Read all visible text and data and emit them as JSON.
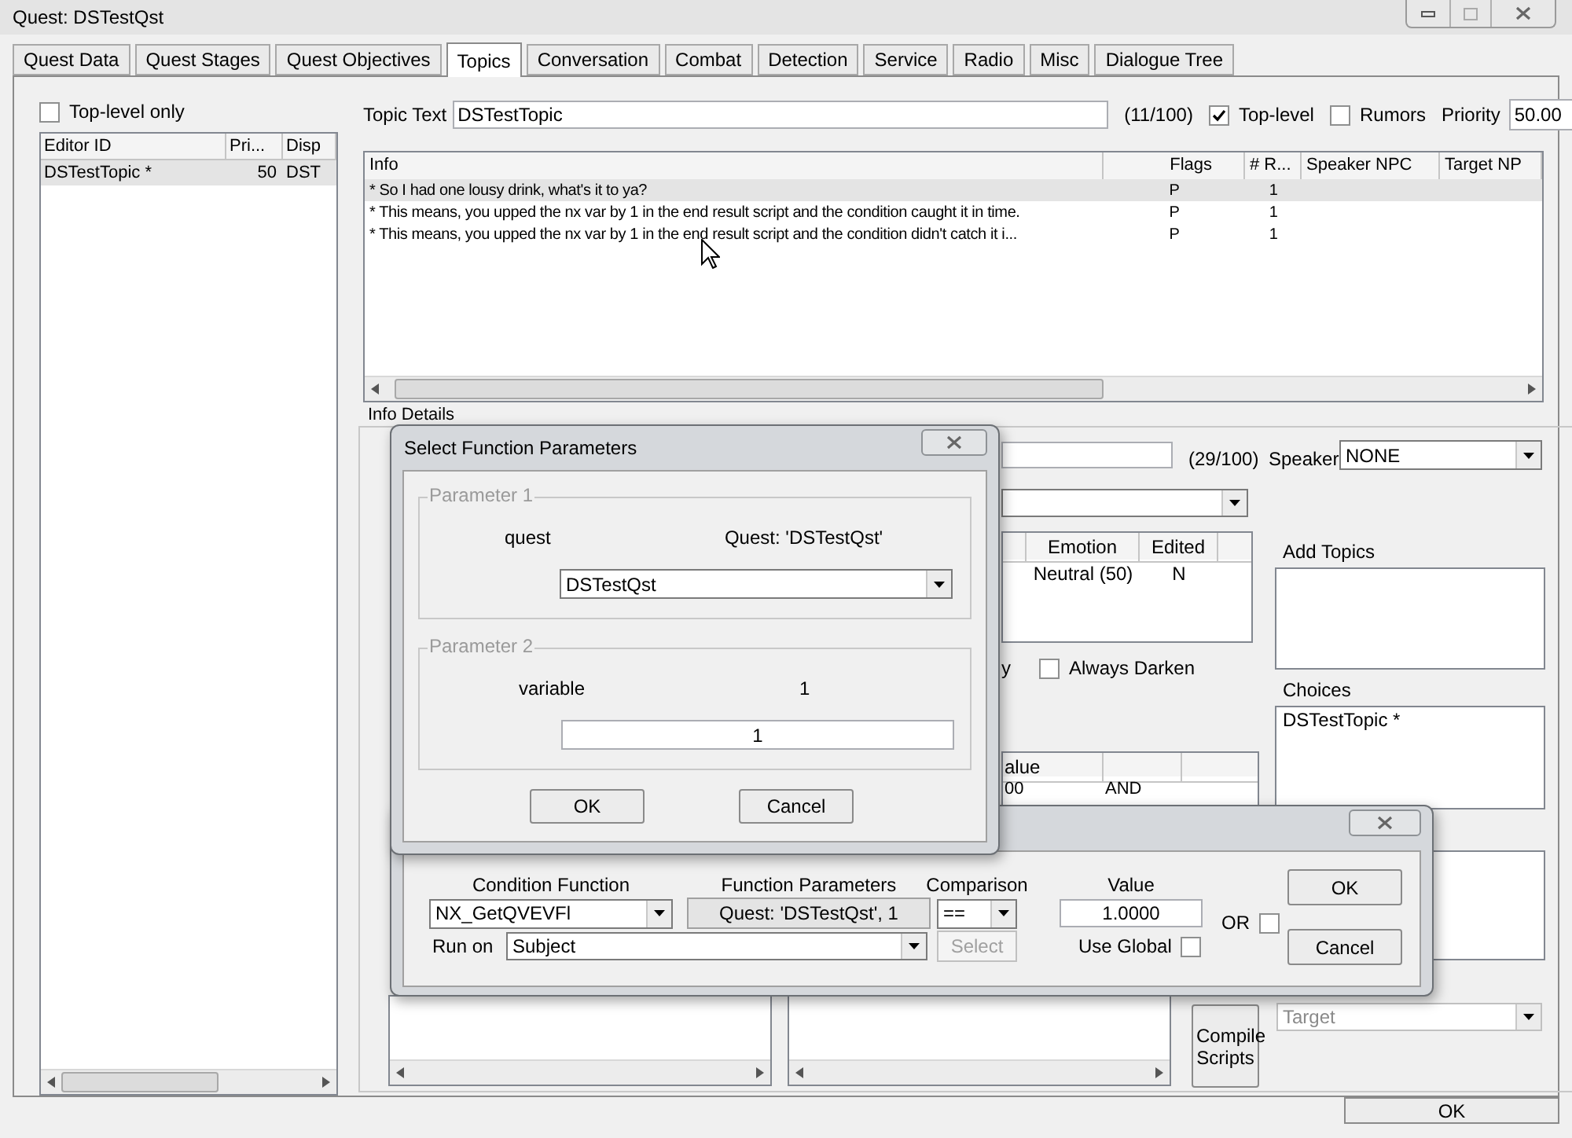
{
  "window": {
    "title": "Quest: DSTestQst"
  },
  "tabs": [
    {
      "label": "Quest Data",
      "selected": false
    },
    {
      "label": "Quest Stages",
      "selected": false
    },
    {
      "label": "Quest Objectives",
      "selected": false
    },
    {
      "label": "Topics",
      "selected": true
    },
    {
      "label": "Conversation",
      "selected": false
    },
    {
      "label": "Combat",
      "selected": false
    },
    {
      "label": "Detection",
      "selected": false
    },
    {
      "label": "Service",
      "selected": false
    },
    {
      "label": "Radio",
      "selected": false
    },
    {
      "label": "Misc",
      "selected": false
    },
    {
      "label": "Dialogue Tree",
      "selected": false
    }
  ],
  "topic_list": {
    "top_level_only": {
      "label": "Top-level only",
      "checked": false
    },
    "columns": [
      "Editor ID",
      "Pri...",
      "Disp"
    ],
    "rows": [
      {
        "cells": [
          "DSTestTopic *",
          "50",
          "DST"
        ],
        "selected": true
      }
    ]
  },
  "topic": {
    "label": "Topic Text",
    "value": "DSTestTopic",
    "count": "(11/100)",
    "top_level": {
      "label": "Top-level",
      "checked": true
    },
    "rumors": {
      "label": "Rumors",
      "checked": false
    },
    "priority_label": "Priority",
    "priority": "50.00"
  },
  "info_table": {
    "columns": [
      "Info",
      "Flags",
      "# R...",
      "Speaker NPC",
      "Target NP"
    ],
    "rows": [
      {
        "cells": [
          "* So I had one lousy drink, what's it to ya?",
          "P",
          "1",
          "",
          ""
        ],
        "selected": true
      },
      {
        "cells": [
          "* This means, you upped the nx var by 1 in the end result script and the condition caught it in time.",
          "P",
          "1",
          "",
          ""
        ],
        "selected": false
      },
      {
        "cells": [
          "* This means, you upped the nx var by 1 in the end result script and the condition didn't catch it i...",
          "P",
          "1",
          "",
          ""
        ],
        "selected": false
      }
    ]
  },
  "info_details": {
    "legend": "Info Details",
    "response_count": "(29/100)",
    "speaker_label": "Speaker",
    "speaker": "NONE",
    "emotion_columns": [
      "Emotion",
      "Edited"
    ],
    "emotion_rows": [
      [
        "Neutral (50)",
        "N"
      ]
    ],
    "cut_label": "y",
    "always_darken": {
      "label": "Always Darken",
      "checked": false
    },
    "add_topics_label": "Add Topics",
    "choices_label": "Choices",
    "choices": [
      "DSTestTopic *"
    ],
    "condition_columns": [
      "alue"
    ],
    "condition_cells": [
      "00",
      "AND"
    ],
    "compile_button": "Compile Scripts",
    "target": {
      "value": "Target",
      "disabled": true
    }
  },
  "ok_button": "OK",
  "params_dialog": {
    "title": "Select Function Parameters",
    "groups": [
      {
        "legend": "Parameter 1",
        "name": "quest",
        "current": "Quest: 'DSTestQst'",
        "kind": "dropdown",
        "value": "DSTestQst"
      },
      {
        "legend": "Parameter 2",
        "name": "variable",
        "current": "1",
        "kind": "field",
        "value": "1"
      }
    ],
    "buttons": [
      "OK",
      "Cancel"
    ]
  },
  "condition_dialog": {
    "function_label": "Condition Function",
    "function": "NX_GetQVEVFl",
    "params_label": "Function Parameters",
    "params_button": "Quest: 'DSTestQst', 1",
    "comparison_label": "Comparison",
    "comparison": "==",
    "value_label": "Value",
    "value": "1.0000",
    "or": {
      "label": "OR",
      "checked": false
    },
    "run_on_label": "Run on",
    "run_on": "Subject",
    "select_button": {
      "label": "Select",
      "disabled": true
    },
    "use_global": {
      "label": "Use Global",
      "checked": false
    },
    "buttons": [
      "OK",
      "Cancel"
    ]
  }
}
